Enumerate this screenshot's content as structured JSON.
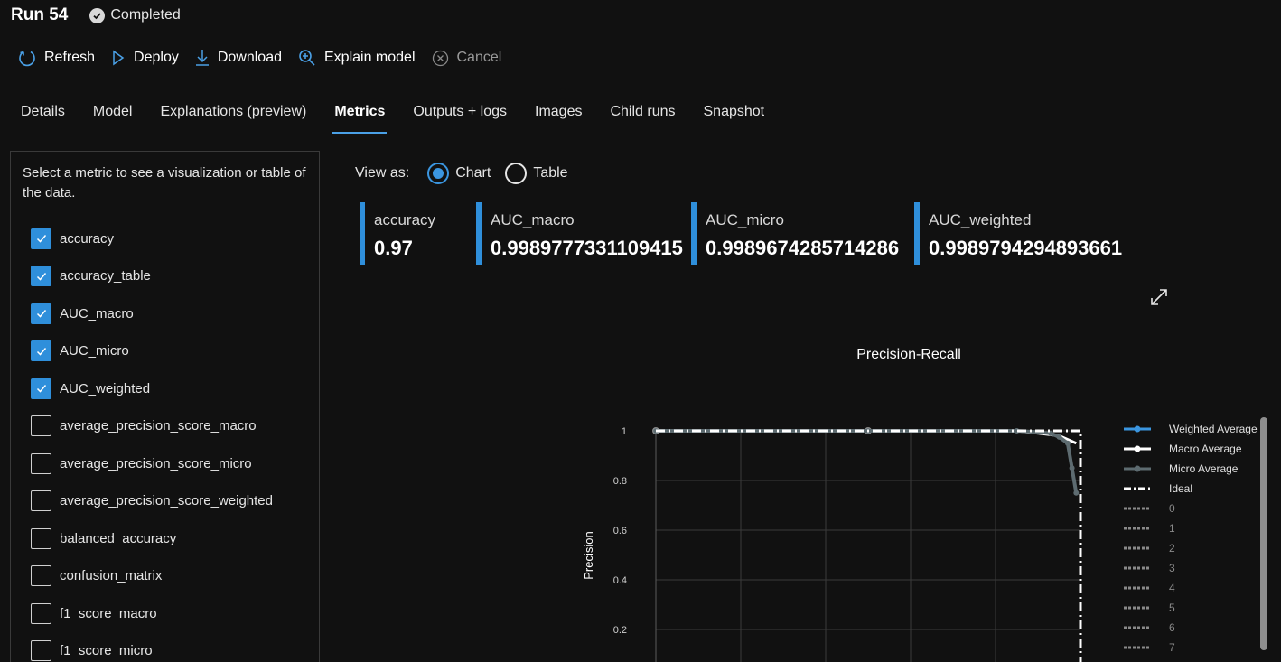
{
  "header": {
    "run_title": "Run 54",
    "status": "Completed"
  },
  "toolbar": {
    "refresh": "Refresh",
    "deploy": "Deploy",
    "download": "Download",
    "explain": "Explain model",
    "cancel": "Cancel"
  },
  "tabs": [
    "Details",
    "Model",
    "Explanations (preview)",
    "Metrics",
    "Outputs + logs",
    "Images",
    "Child runs",
    "Snapshot"
  ],
  "active_tab": "Metrics",
  "panel": {
    "description": "Select a metric to see a visualization or table of the data.",
    "metrics": [
      {
        "label": "accuracy",
        "checked": true
      },
      {
        "label": "accuracy_table",
        "checked": true
      },
      {
        "label": "AUC_macro",
        "checked": true
      },
      {
        "label": "AUC_micro",
        "checked": true
      },
      {
        "label": "AUC_weighted",
        "checked": true
      },
      {
        "label": "average_precision_score_macro",
        "checked": false
      },
      {
        "label": "average_precision_score_micro",
        "checked": false
      },
      {
        "label": "average_precision_score_weighted",
        "checked": false
      },
      {
        "label": "balanced_accuracy",
        "checked": false
      },
      {
        "label": "confusion_matrix",
        "checked": false
      },
      {
        "label": "f1_score_macro",
        "checked": false
      },
      {
        "label": "f1_score_micro",
        "checked": false
      }
    ]
  },
  "view_as": {
    "label": "View as:",
    "chart": "Chart",
    "table": "Table",
    "selected": "Chart"
  },
  "cards": [
    {
      "label": "accuracy",
      "value": "0.97"
    },
    {
      "label": "AUC_macro",
      "value": "0.9989777331109415"
    },
    {
      "label": "AUC_micro",
      "value": "0.9989674285714286"
    },
    {
      "label": "AUC_weighted",
      "value": "0.9989794294893661"
    }
  ],
  "colors": {
    "accent": "#2f8fdb",
    "weighted": "#3b96e0",
    "macro": "#ffffff",
    "micro": "#5d6b70",
    "ideal": "#ffffff"
  },
  "chart_data": {
    "type": "line",
    "title": "Precision-Recall",
    "ylabel": "Precision",
    "xlabel": "",
    "ylim": [
      0,
      1
    ],
    "xlim": [
      0,
      1
    ],
    "yticks": [
      1,
      0.8,
      0.6,
      0.4,
      0.2
    ],
    "grid": true,
    "legend_position": "right",
    "series": [
      {
        "name": "Weighted Average",
        "x": [
          0,
          0.5,
          0.85,
          0.9,
          0.93,
          0.95,
          0.97,
          0.98,
          0.99
        ],
        "y": [
          1,
          1,
          1,
          0.995,
          0.99,
          0.975,
          0.95,
          0.85,
          0.75
        ]
      },
      {
        "name": "Macro Average",
        "x": [
          0,
          0.3,
          0.5,
          0.7,
          0.85,
          0.95,
          0.99
        ],
        "y": [
          1,
          1,
          1,
          1,
          1,
          0.98,
          0.95
        ]
      },
      {
        "name": "Micro Average",
        "x": [
          0,
          0.5,
          0.85,
          0.9,
          0.93,
          0.95,
          0.97,
          0.98,
          0.99
        ],
        "y": [
          1,
          1,
          1,
          0.995,
          0.99,
          0.975,
          0.95,
          0.85,
          0.75
        ]
      },
      {
        "name": "Ideal",
        "x": [
          0,
          1,
          1
        ],
        "y": [
          1,
          1,
          0
        ]
      },
      {
        "name": "0"
      },
      {
        "name": "1"
      },
      {
        "name": "2"
      },
      {
        "name": "3"
      },
      {
        "name": "4"
      },
      {
        "name": "5"
      },
      {
        "name": "6"
      },
      {
        "name": "7"
      }
    ]
  }
}
